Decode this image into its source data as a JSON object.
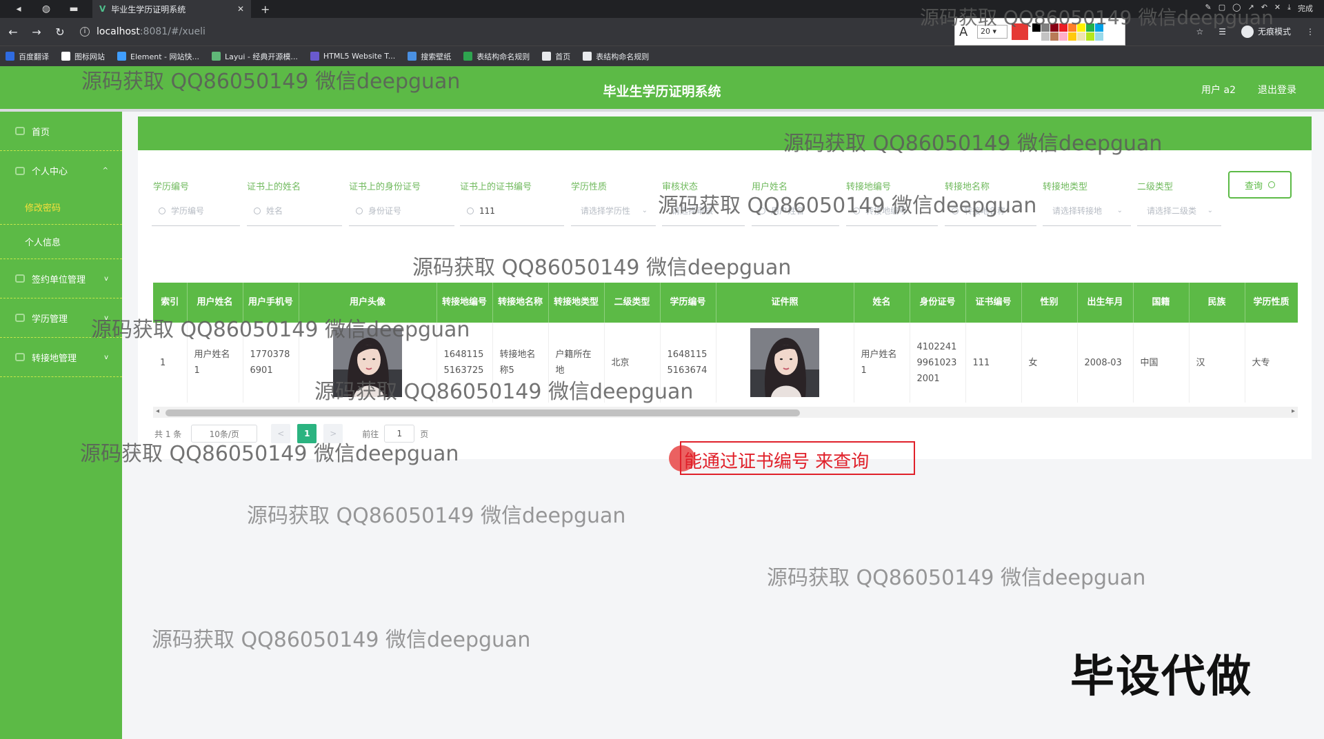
{
  "browser": {
    "tab_title": "毕业生学历证明系统",
    "tab_close": "✕",
    "new_tab": "+",
    "url_host": "localhost",
    "url_path": ":8081/#/xueli",
    "incognito_label": "无痕模式",
    "bookmarks": [
      {
        "label": "百度翻译",
        "color": "#2f6be0"
      },
      {
        "label": "图标网站",
        "color": "#ffffff"
      },
      {
        "label": "Element - 网站快...",
        "color": "#409eff"
      },
      {
        "label": "Layui - 经典开源模...",
        "color": "#5fb878"
      },
      {
        "label": "HTML5 Website T...",
        "color": "#6a5acd"
      },
      {
        "label": "搜索壁纸",
        "color": "#4a90e2"
      },
      {
        "label": "表结构命名规则",
        "color": "#2ea44f"
      },
      {
        "label": "首页",
        "color": "#e8eaed"
      },
      {
        "label": "表结构命名规则",
        "color": "#e8eaed"
      }
    ]
  },
  "annotation_tool": {
    "font_letter": "A",
    "font_size": "20",
    "current_color": "#e53935",
    "palette": [
      "#000000",
      "#7f7f7f",
      "#880015",
      "#ed1c24",
      "#ff7f27",
      "#fff200",
      "#22b14c",
      "#00a2e8",
      "#ffffff",
      "#c3c3c3",
      "#b97a57",
      "#ffaec9",
      "#ffc90e",
      "#efe4b0",
      "#b5e61d",
      "#99d9ea"
    ],
    "done_label": "完成"
  },
  "header": {
    "title": "毕业生学历证明系统",
    "user_label": "用户 a2",
    "logout_label": "退出登录"
  },
  "sidebar": {
    "items": [
      {
        "label": "首页"
      },
      {
        "label": "个人中心",
        "chevron": "^"
      },
      {
        "label": "修改密码"
      },
      {
        "label": "个人信息"
      },
      {
        "label": "签约单位管理",
        "chevron": "v"
      },
      {
        "label": "学历管理",
        "chevron": "v"
      },
      {
        "label": "转接地管理",
        "chevron": "v"
      }
    ]
  },
  "filters": {
    "labels": [
      "学历编号",
      "证书上的姓名",
      "证书上的身份证号",
      "证书上的证书编号",
      "学历性质",
      "审核状态",
      "用户姓名",
      "转接地编号",
      "转接地名称",
      "转接地类型",
      "二级类型"
    ],
    "inputs": [
      {
        "placeholder": "学历编号",
        "value": ""
      },
      {
        "placeholder": "姓名",
        "value": ""
      },
      {
        "placeholder": "身份证号",
        "value": ""
      },
      {
        "placeholder": "",
        "value": "111"
      },
      {
        "placeholder": "请选择学历性",
        "value": ""
      },
      {
        "placeholder": "请选择审核",
        "value": ""
      },
      {
        "placeholder": "用户姓名",
        "value": ""
      },
      {
        "placeholder": "转接地编号",
        "value": ""
      },
      {
        "placeholder": "转接地名称",
        "value": ""
      },
      {
        "placeholder": "请选择转接地",
        "value": ""
      },
      {
        "placeholder": "请选择二级类",
        "value": ""
      }
    ],
    "query_label": "查询"
  },
  "table": {
    "headers": [
      "索引",
      "用户姓名",
      "用户手机号",
      "用户头像",
      "转接地编号",
      "转接地名称",
      "转接地类型",
      "二级类型",
      "学历编号",
      "证件照",
      "姓名",
      "身份证号",
      "证书编号",
      "性别",
      "出生年月",
      "国籍",
      "民族",
      "学历性质"
    ],
    "row": {
      "index": "1",
      "user_name": "用户姓名1",
      "phone": "17703786901",
      "transfer_no": "16481155163725",
      "transfer_name": "转接地名称5",
      "transfer_type": "户籍所在地",
      "secondary_type": "北京",
      "edu_no": "16481155163674",
      "name": "用户姓名1",
      "id_no": "410224199610232001",
      "cert_no": "111",
      "gender": "女",
      "birth": "2008-03",
      "nationality": "中国",
      "ethnicity": "汉",
      "edu_type": "大专"
    }
  },
  "pagination": {
    "total": "共 1 条",
    "page_size": "10条/页",
    "prev": "<",
    "current": "1",
    "next": ">",
    "goto_prefix": "前往",
    "goto_value": "1",
    "goto_suffix": "页"
  },
  "annotation_callout": "能通过证书编号 来查询",
  "watermark": "源码获取 QQ86050149 微信deepguan",
  "stamp": "毕设代做"
}
